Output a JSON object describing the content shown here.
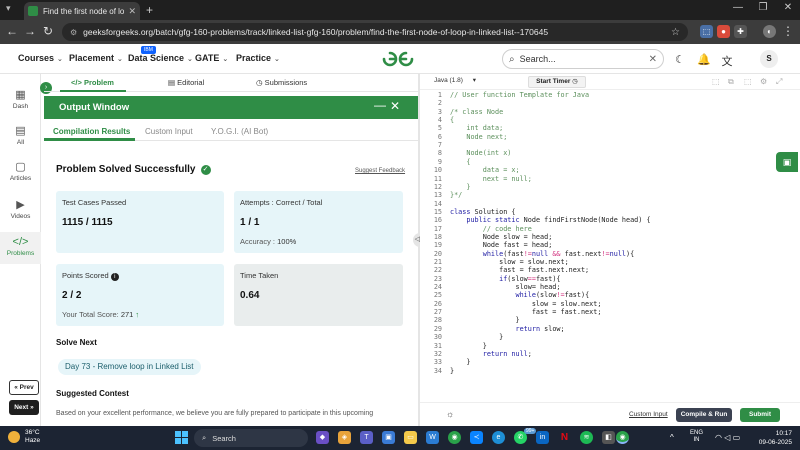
{
  "browser": {
    "tab_title": "Find the first node of loop in li",
    "tab_close": "✕",
    "new_tab": "+",
    "url": "geeksforgeeks.org/batch/gfg-160-problems/track/linked-list-gfg-160/problem/find-the-first-node-of-loop-in-linked-list--170645",
    "win_min": "—",
    "win_max": "❐",
    "win_close": "✕"
  },
  "gfg_header": {
    "menus": [
      "Courses",
      "Placement",
      "Data Science",
      "GATE",
      "Practice"
    ],
    "ibm_badge": "IBM",
    "search_placeholder": "Search...",
    "avatar_letter": "S"
  },
  "sidebar": {
    "items": [
      {
        "icon": "dashboard-icon",
        "label": "Dash"
      },
      {
        "icon": "all-icon",
        "label": "All"
      },
      {
        "icon": "articles-icon",
        "label": "Articles"
      },
      {
        "icon": "videos-icon",
        "label": "Videos"
      },
      {
        "icon": "problems-icon",
        "label": "Problems"
      }
    ],
    "prev_label": "« Prev",
    "next_label": "Next »"
  },
  "problem_tabs": [
    "Problem",
    "Editorial",
    "Submissions"
  ],
  "output_window": {
    "title": "Output Window",
    "tabs": [
      "Compilation Results",
      "Custom Input",
      "Y.O.G.I. (AI Bot)"
    ],
    "status": "Problem Solved Successfully",
    "suggest_feedback": "Suggest Feedback",
    "cards": {
      "test_cases_label": "Test Cases Passed",
      "test_cases_value": "1115 / 1115",
      "attempts_label": "Attempts : Correct / Total",
      "attempts_value": "1 / 1",
      "accuracy_label": "Accuracy :",
      "accuracy_value": "100%",
      "points_label": "Points Scored",
      "points_value": "2 / 2",
      "total_score_label": "Your Total Score:",
      "total_score_value": "271",
      "time_label": "Time Taken",
      "time_value": "0.64"
    },
    "solve_next_heading": "Solve Next",
    "solve_next_item": "Day 73 - Remove loop in Linked List",
    "suggested_heading": "Suggested Contest",
    "suggested_text": "Based on your excellent performance, we believe you are fully prepared to participate in this upcoming"
  },
  "editor": {
    "language": "Java (1.8)",
    "timer_label": "Start Timer",
    "custom_input": "Custom Input",
    "compile_label": "Compile & Run",
    "submit_label": "Submit",
    "lines": [
      "// User function Template for Java",
      "",
      "/* class Node",
      "{",
      "    int data;",
      "    Node next;",
      "",
      "    Node(int x)",
      "    {",
      "        data = x;",
      "        next = null;",
      "    }",
      "}*/",
      "",
      "class Solution {",
      "    public static Node findFirstNode(Node head) {",
      "        // code here",
      "        Node slow = head;",
      "        Node fast = head;",
      "        while(fast!=null && fast.next!=null){",
      "            slow = slow.next;",
      "            fast = fast.next.next;",
      "            if(slow==fast){",
      "                slow= head;",
      "                while(slow!=fast){",
      "                    slow = slow.next;",
      "                    fast = fast.next;",
      "                }",
      "                return slow;",
      "            }",
      "        }",
      "        return null;",
      "    }",
      "}"
    ]
  },
  "taskbar": {
    "temperature": "36°C",
    "weather": "Haze",
    "search_label": "Search",
    "lang_top": "ENG",
    "lang_bottom": "IN",
    "time": "10:17",
    "date": "09-06-2025",
    "badge": "99+"
  }
}
